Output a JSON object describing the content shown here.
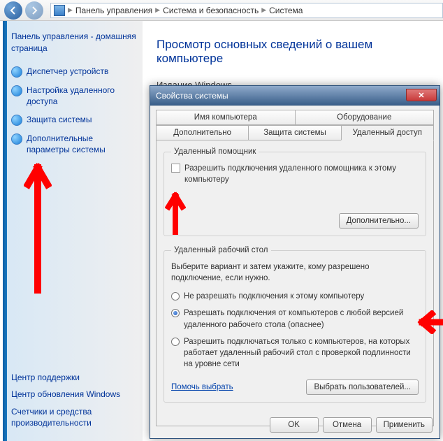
{
  "breadcrumb": {
    "root": "Панель управления",
    "mid": "Система и безопасность",
    "leaf": "Система"
  },
  "sidebar": {
    "home": "Панель управления - домашняя страница",
    "tasks": [
      "Диспетчер устройств",
      "Настройка удаленного доступа",
      "Защита системы",
      "Дополнительные параметры системы"
    ],
    "bottom": [
      "Центр поддержки",
      "Центр обновления Windows",
      "Счетчики и средства производительности"
    ]
  },
  "main": {
    "title": "Просмотр основных сведений о вашем компьютере",
    "edition_label": "Издание Windows"
  },
  "dialog": {
    "title": "Свойства системы",
    "tabs_row1": [
      "Имя компьютера",
      "Оборудование"
    ],
    "tabs_row2": [
      "Дополнительно",
      "Защита системы",
      "Удаленный доступ"
    ],
    "ra_group": {
      "legend": "Удаленный помощник",
      "checkbox": "Разрешить подключения удаленного помощника к этому компьютеру",
      "adv_btn": "Дополнительно..."
    },
    "rd_group": {
      "legend": "Удаленный рабочий стол",
      "desc": "Выберите вариант и затем укажите, кому разрешено подключение, если нужно.",
      "opt1": "Не разрешать подключения к этому компьютеру",
      "opt2": "Разрешать подключения от компьютеров с любой версией удаленного рабочего стола (опаснее)",
      "opt3": "Разрешить подключаться только с компьютеров, на которых работает удаленный рабочий стол с проверкой подлинности на уровне сети",
      "help": "Помочь выбрать",
      "users_btn": "Выбрать пользователей..."
    },
    "ok": "OK",
    "cancel": "Отмена",
    "apply": "Применить"
  }
}
